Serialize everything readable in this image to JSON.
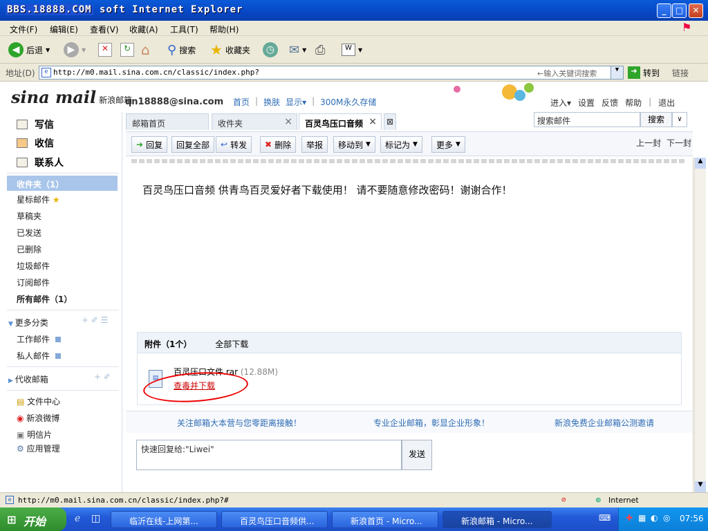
{
  "window": {
    "title": "BBS.18888.COM soft Internet Explorer",
    "title_overlay": "BBS.18888.COM",
    "title_rest": "soft Internet Explorer"
  },
  "menu": [
    "文件(F)",
    "编辑(E)",
    "查看(V)",
    "收藏(A)",
    "工具(T)",
    "帮助(H)"
  ],
  "toolbar": {
    "back": "后退",
    "search": "搜索",
    "favorites": "收藏夹"
  },
  "address": {
    "label": "地址(D)",
    "url": "http://m0.mail.sina.com.cn/classic/index.php?",
    "search_hint": "←输入关键词搜索",
    "go": "转到",
    "links": "链接"
  },
  "mail": {
    "logo": "sina mail",
    "logo_sub": "新浪邮箱",
    "account": "qn18888@sina.com",
    "top_links": [
      "首页",
      "|",
      "换肤",
      "显示▾",
      "|",
      "300M永久存储"
    ],
    "right_links": [
      "进入▾",
      "设置",
      "反馈",
      "帮助",
      "|",
      "退出"
    ],
    "search_placeholder": "搜索邮件",
    "search_button": "搜索",
    "sidebar": {
      "write": "写信",
      "receive": "收信",
      "contacts": "联系人",
      "inbox": "收件夹（1）",
      "folders": [
        "星标邮件",
        "草稿夹",
        "已发送",
        "已删除",
        "垃圾邮件",
        "订阅邮件"
      ],
      "all": "所有邮件（1）",
      "more": "更多分类",
      "custom": [
        "工作邮件",
        "私人邮件"
      ],
      "proxy": "代收邮箱",
      "apps": [
        "文件中心",
        "新浪微博",
        "明信片",
        "应用管理"
      ]
    },
    "tabs": [
      "邮箱首页",
      "收件夹",
      "百灵鸟压口音频"
    ],
    "actions": [
      "回复",
      "回复全部",
      "转发",
      "删除",
      "举报",
      "移动到",
      "标记为",
      "更多"
    ],
    "prev": "上一封",
    "next": "下一封",
    "body": "百灵鸟压口音频 供青鸟百灵爱好者下载使用！ 请不要随意修改密码！谢谢合作！",
    "attach_label": "附件（1个）",
    "attach_all": "全部下载",
    "attach_name": "百灵压口文件.rar",
    "attach_size": "(12.88M)",
    "attach_link": "查毒并下载",
    "footer_links": [
      "关注邮箱大本营与您零距离接触！",
      "专业企业邮箱，彰显企业形象！",
      "新浪免费企业邮箱公测邀请"
    ],
    "quick_reply": "快速回复给:\"Liwei\"",
    "send": "发送"
  },
  "status": {
    "url": "http://m0.mail.sina.com.cn/classic/index.php?#",
    "zone": "Internet"
  },
  "taskbar": {
    "start": "开始",
    "tasks": [
      "临沂在线-上网第...",
      "百灵鸟压口音频供...",
      "新浪首页 - Micro...",
      "新浪邮箱 - Micro..."
    ],
    "clock": "07:56"
  }
}
